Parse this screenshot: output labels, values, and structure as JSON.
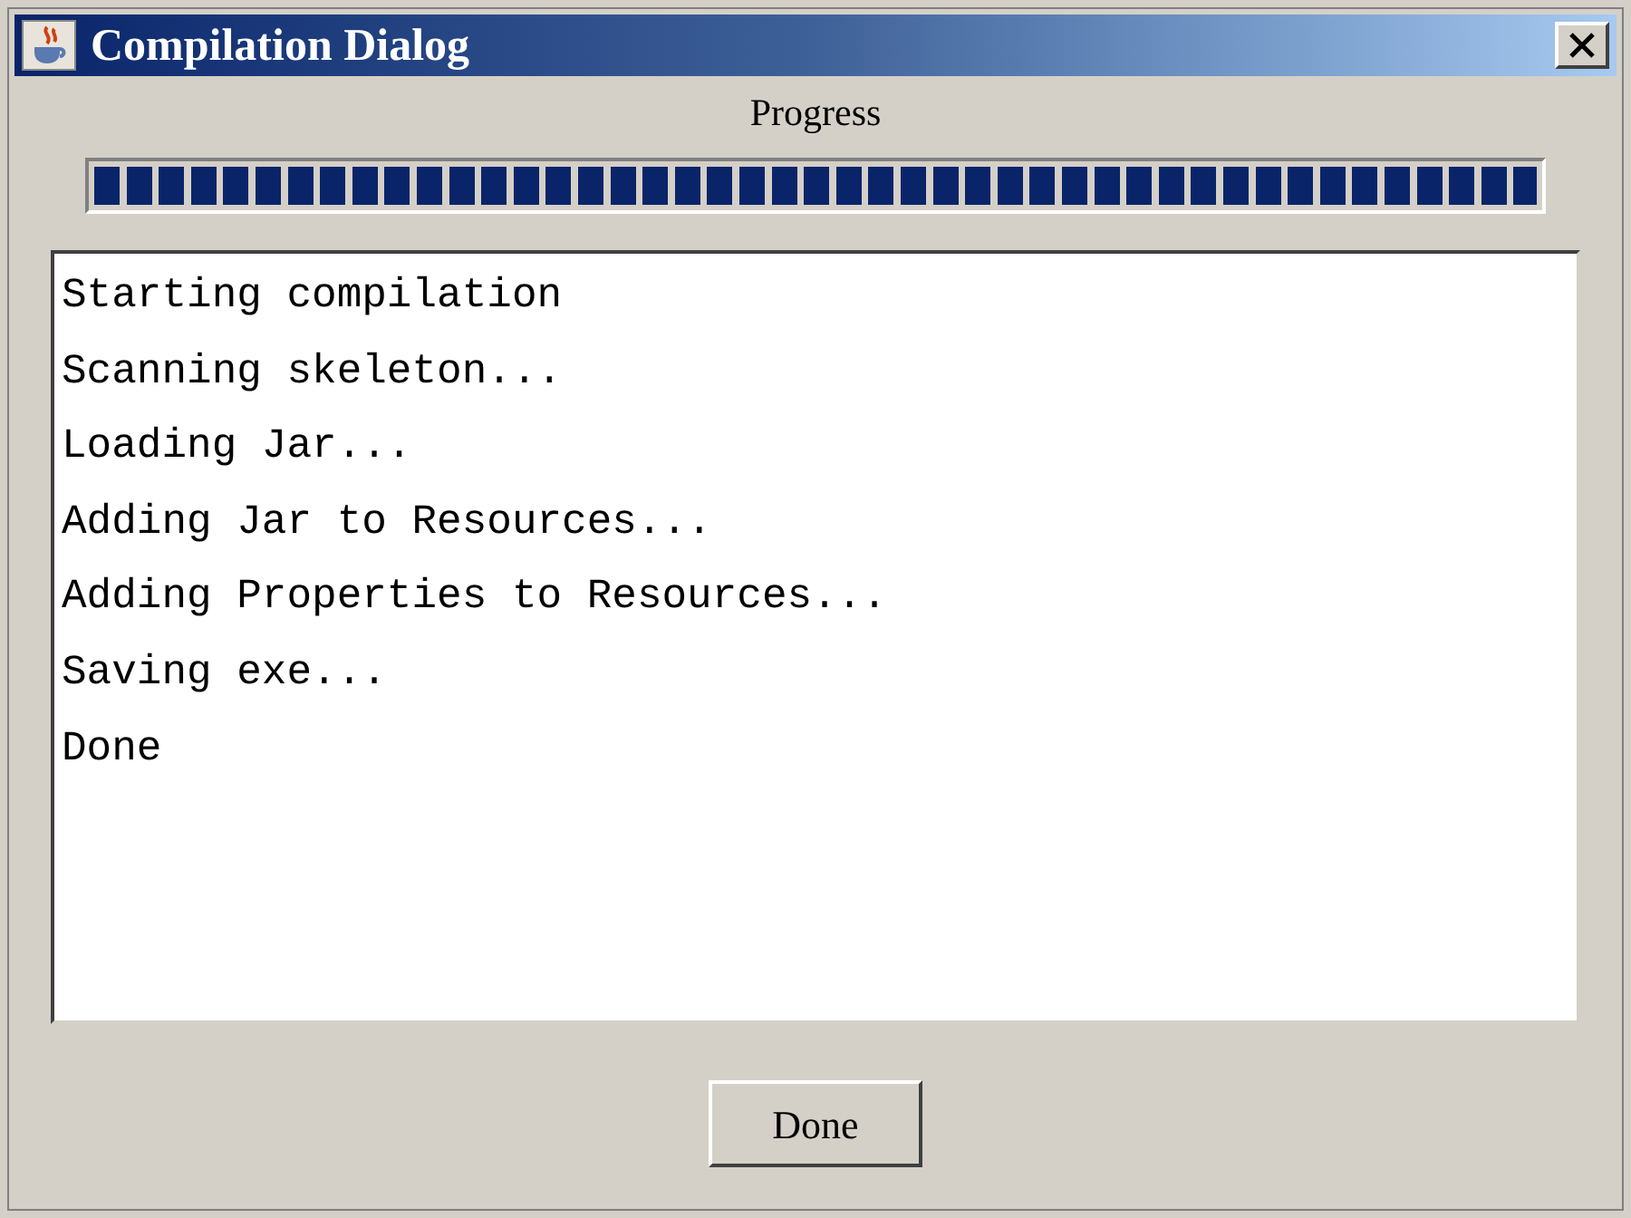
{
  "window": {
    "title": "Compilation Dialog"
  },
  "progress": {
    "label": "Progress",
    "level": 1
  },
  "log": [
    "Starting compilation",
    "Scanning skeleton...",
    "Loading Jar...",
    "Adding Jar to Resources...",
    "Adding Properties to Resources...",
    "Saving exe...",
    "Done"
  ],
  "buttons": [
    "Done"
  ]
}
